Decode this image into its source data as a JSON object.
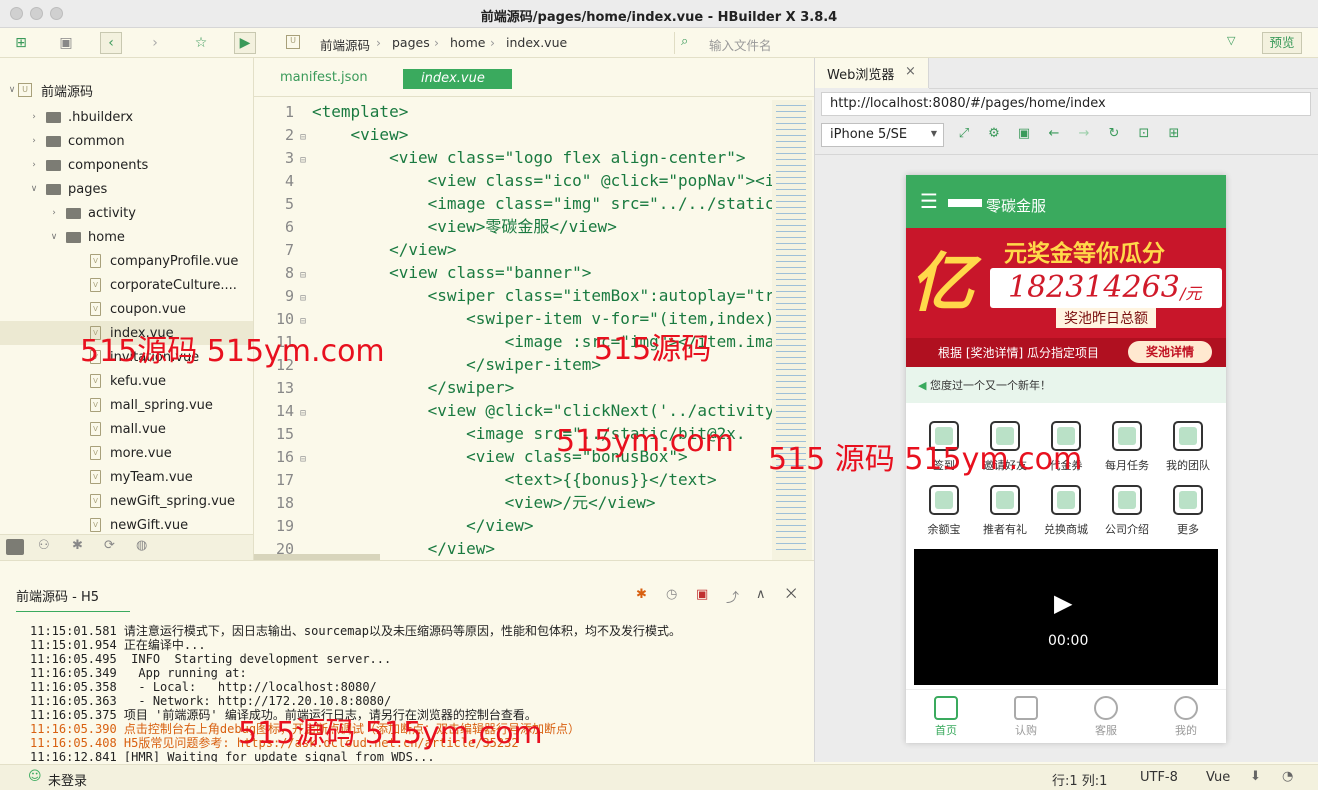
{
  "window": {
    "title": "前端源码/pages/home/index.vue - HBuilder X 3.8.4"
  },
  "toolbar": {
    "breadcrumb": [
      "前端源码",
      "pages",
      "home",
      "index.vue"
    ],
    "file_search_placeholder": "输入文件名",
    "preview_label": "预览"
  },
  "tree": {
    "root": "前端源码",
    "items": [
      ".hbuilderx",
      "common",
      "components",
      "pages",
      "activity",
      "home",
      "companyProfile.vue",
      "corporateCulture....",
      "coupon.vue",
      "index.vue",
      "invitation.vue",
      "kefu.vue",
      "mall_spring.vue",
      "mall.vue",
      "more.vue",
      "myTeam.vue",
      "newGift_spring.vue",
      "newGift.vue"
    ]
  },
  "editor": {
    "tabs": [
      "manifest.json",
      "index.vue"
    ],
    "lines": [
      {
        "n": "1",
        "text": "<template>"
      },
      {
        "n": "2",
        "text": "    <view>"
      },
      {
        "n": "3",
        "text": "        <view class=\"logo flex align-center\">"
      },
      {
        "n": "4",
        "text": "            <view class=\"ico\" @click=\"popNav\"><i"
      },
      {
        "n": "5",
        "text": "            <image class=\"img\" src=\"../../static"
      },
      {
        "n": "6",
        "text": "            <view>零碳金服</view>"
      },
      {
        "n": "7",
        "text": "        </view>"
      },
      {
        "n": "8",
        "text": "        <view class=\"banner\">"
      },
      {
        "n": "9",
        "text": "            <swiper class=\"itemBox\":autoplay=\"tr"
      },
      {
        "n": "10",
        "text": "                <swiper-item v-for=\"(item,index)"
      },
      {
        "n": "11",
        "text": "                    <image :src=\"img\"></item.ima"
      },
      {
        "n": "12",
        "text": "                </swiper-item>"
      },
      {
        "n": "13",
        "text": "            </swiper>"
      },
      {
        "n": "14",
        "text": "            <view @click=\"clickNext('../activity"
      },
      {
        "n": "15",
        "text": "                <image src=\"../static/bit@2x."
      },
      {
        "n": "16",
        "text": "                <view class=\"bonusBox\">"
      },
      {
        "n": "17",
        "text": "                    <text>{{bonus}}</text>"
      },
      {
        "n": "18",
        "text": "                    <view>/元</view>"
      },
      {
        "n": "19",
        "text": "                </view>"
      },
      {
        "n": "20",
        "text": "            </view>"
      }
    ]
  },
  "browser": {
    "tab_label": "Web浏览器",
    "url": "http://localhost:8080/#/pages/home/index",
    "device": "iPhone 5/SE"
  },
  "app": {
    "brand": "零碳金服",
    "banner_headline": "元奖金等你瓜分",
    "banner_yi": "亿",
    "bonus_amount": "182314263",
    "bonus_unit": "/元",
    "bonus_caption": "奖池昨日总额",
    "banner_footer": "根据 [奖池详情] 瓜分指定项目",
    "banner_button": "奖池详情",
    "notice": "您度过一个又一个新年！",
    "grid": [
      "签到",
      "邀请好友",
      "代金券",
      "每月任务",
      "我的团队",
      "余额宝",
      "推者有礼",
      "兑换商城",
      "公司介绍",
      "更多"
    ],
    "video_time": "00:00",
    "nav": [
      "首页",
      "认购",
      "客服",
      "我的"
    ]
  },
  "console": {
    "tab_label": "前端源码 - H5",
    "lines": [
      {
        "t": "11:15:01.581 请注意运行模式下，因日志输出、sourcemap以及未压缩源码等原因，性能和包体积，均不及发行模式。",
        "c": ""
      },
      {
        "t": "11:15:01.954 正在编译中...",
        "c": ""
      },
      {
        "t": "11:16:05.495  INFO  Starting development server...",
        "c": ""
      },
      {
        "t": "11:16:05.349   App running at:",
        "c": ""
      },
      {
        "t": "11:16:05.358   - Local:   http://localhost:8080/",
        "c": ""
      },
      {
        "t": "11:16:05.363   - Network: http://172.20.10.8:8080/",
        "c": ""
      },
      {
        "t": "11:16:05.375 项目 '前端源码' 编译成功。前端运行日志，请另行在浏览器的控制台查看。",
        "c": ""
      },
      {
        "t": "11:16:05.390 点击控制台右上角debug图标，开启断点调试（添加断点：双击编辑器行号添加断点）",
        "c": "or"
      },
      {
        "t": "11:16:05.408 H5版常见问题参考: https://ask.dcloud.net.cn/article/35232",
        "c": "or"
      },
      {
        "t": "11:16:12.841 [HMR] Waiting for update signal from WDS...",
        "c": ""
      }
    ]
  },
  "status": {
    "login": "未登录",
    "position": "行:1  列:1",
    "encoding": "UTF-8",
    "lang": "Vue"
  },
  "watermarks": [
    "515源码 515ym.com",
    "515源码",
    "515ym.com",
    "515 源码 515ym.com",
    "515源码 515ym.com"
  ],
  "colors": {
    "accent": "#3aaa5e",
    "banner": "#c8162a",
    "editor_bg": "#fbf9ea"
  }
}
